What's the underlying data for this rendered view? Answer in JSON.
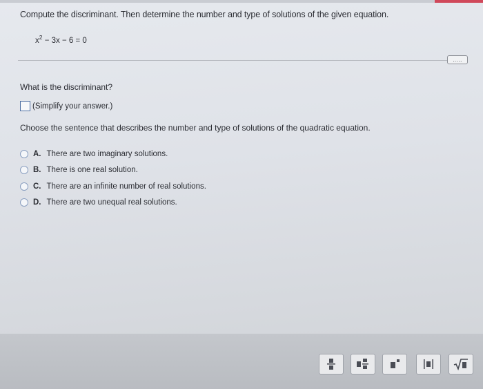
{
  "question": {
    "prompt": "Compute the discriminant. Then determine the number and type of solutions of the given equation.",
    "equation": {
      "base": "x",
      "exponent": "2",
      "rest": "− 3x − 6 = 0"
    }
  },
  "more_button": {
    "label": "....."
  },
  "part1": {
    "question": "What is the discriminant?",
    "answer_value": "",
    "hint": "(Simplify your answer.)"
  },
  "part2": {
    "question": "Choose the sentence that describes the number and type of solutions of the quadratic equation.",
    "options": [
      {
        "letter": "A.",
        "text": "There are two imaginary solutions."
      },
      {
        "letter": "B.",
        "text": "There is one real solution."
      },
      {
        "letter": "C.",
        "text": "There are an infinite number of real solutions."
      },
      {
        "letter": "D.",
        "text": "There are two unequal real solutions."
      }
    ]
  },
  "toolbar": {
    "tools": [
      "fraction-icon",
      "mixed-number-icon",
      "exponent-icon",
      "absolute-value-icon",
      "square-root-icon"
    ]
  },
  "colors": {
    "accent": "#d0485a",
    "answer_border": "#4e6fa3",
    "radio_border": "#8a9fc0"
  }
}
